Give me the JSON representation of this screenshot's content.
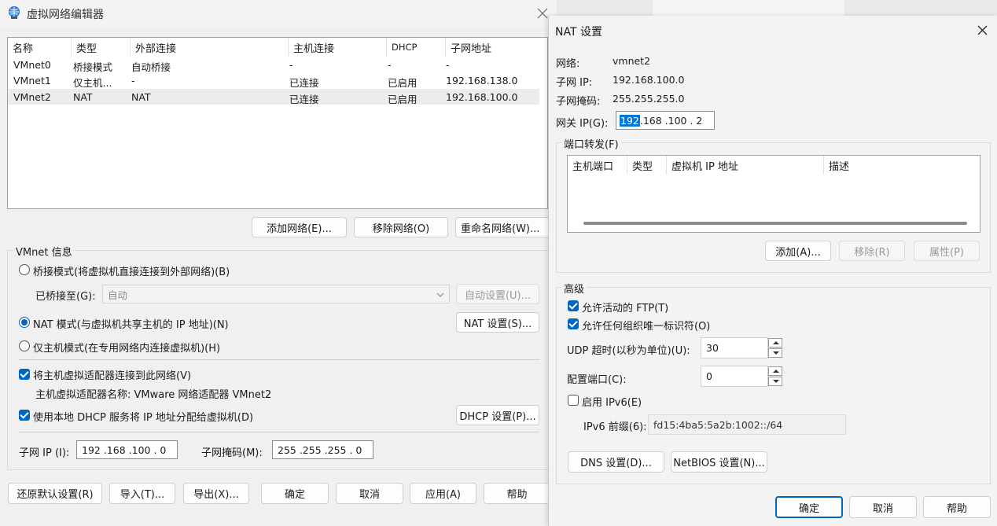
{
  "main": {
    "title": "虚拟网络编辑器",
    "columns": [
      "名称",
      "类型",
      "外部连接",
      "主机连接",
      "DHCP",
      "子网地址"
    ],
    "rows": [
      [
        "VMnet0",
        "桥接模式",
        "自动桥接",
        "-",
        "-",
        "-"
      ],
      [
        "VMnet1",
        "仅主机...",
        "-",
        "已连接",
        "已启用",
        "192.168.138.0"
      ],
      [
        "VMnet2",
        "NAT",
        "NAT",
        "已连接",
        "已启用",
        "192.168.100.0"
      ]
    ],
    "add_network": "添加网络(E)...",
    "remove_network": "移除网络(O)",
    "rename_network": "重命名网络(W)...",
    "vmnet_info": "VMnet 信息",
    "bridged_mode": "桥接模式(将虚拟机直接连接到外部网络)(B)",
    "bridged_to_label": "已桥接至(G):",
    "bridged_to_value": "自动",
    "auto_settings": "自动设置(U)...",
    "nat_mode": "NAT 模式(与虚拟机共享主机的 IP 地址)(N)",
    "nat_settings": "NAT 设置(S)...",
    "host_only_mode": "仅主机模式(在专用网络内连接虚拟机)(H)",
    "connect_adapter": "将主机虚拟适配器连接到此网络(V)",
    "adapter_name": "主机虚拟适配器名称: VMware 网络适配器 VMnet2",
    "use_dhcp": "使用本地 DHCP 服务将 IP 地址分配给虚拟机(D)",
    "dhcp_settings": "DHCP 设置(P)...",
    "subnet_ip_label": "子网 IP (I):",
    "subnet_ip_value": "192 .168 .100 .  0",
    "subnet_mask_label": "子网掩码(M):",
    "subnet_mask_value": "255 .255 .255 .  0",
    "restore_defaults": "还原默认设置(R)",
    "import": "导入(T)...",
    "export": "导出(X)...",
    "ok": "确定",
    "cancel": "取消",
    "apply": "应用(A)",
    "help": "帮助"
  },
  "nat": {
    "title": "NAT 设置",
    "network_label": "网络:",
    "network_value": "vmnet2",
    "subnet_ip_label": "子网 IP:",
    "subnet_ip_value": "192.168.100.0",
    "subnet_mask_label": "子网掩码:",
    "subnet_mask_value": "255.255.255.0",
    "gateway_label": "网关 IP(G):",
    "gateway_sel": "192",
    "gateway_rest": " .168 .100 .  2",
    "port_forward": "端口转发(F)",
    "pf_columns": [
      "主机端口",
      "类型",
      "虚拟机 IP 地址",
      "描述"
    ],
    "add": "添加(A)...",
    "remove": "移除(R)",
    "properties": "属性(P)",
    "advanced": "高级",
    "allow_ftp": "允许活动的 FTP(T)",
    "allow_any_oui": "允许任何组织唯一标识符(O)",
    "udp_timeout_label": "UDP 超时(以秒为单位)(U):",
    "udp_timeout_value": "30",
    "config_port_label": "配置端口(C):",
    "config_port_value": "0",
    "enable_ipv6": "启用 IPv6(E)",
    "ipv6_prefix_label": "IPv6 前缀(6):",
    "ipv6_prefix_value": "fd15:4ba5:5a2b:1002::/64",
    "dns_settings": "DNS 设置(D)...",
    "netbios_settings": "NetBIOS 设置(N)...",
    "ok": "确定",
    "cancel": "取消",
    "help": "帮助"
  },
  "colors": {
    "accent": "#0067c0",
    "selection": "#0078d7"
  }
}
